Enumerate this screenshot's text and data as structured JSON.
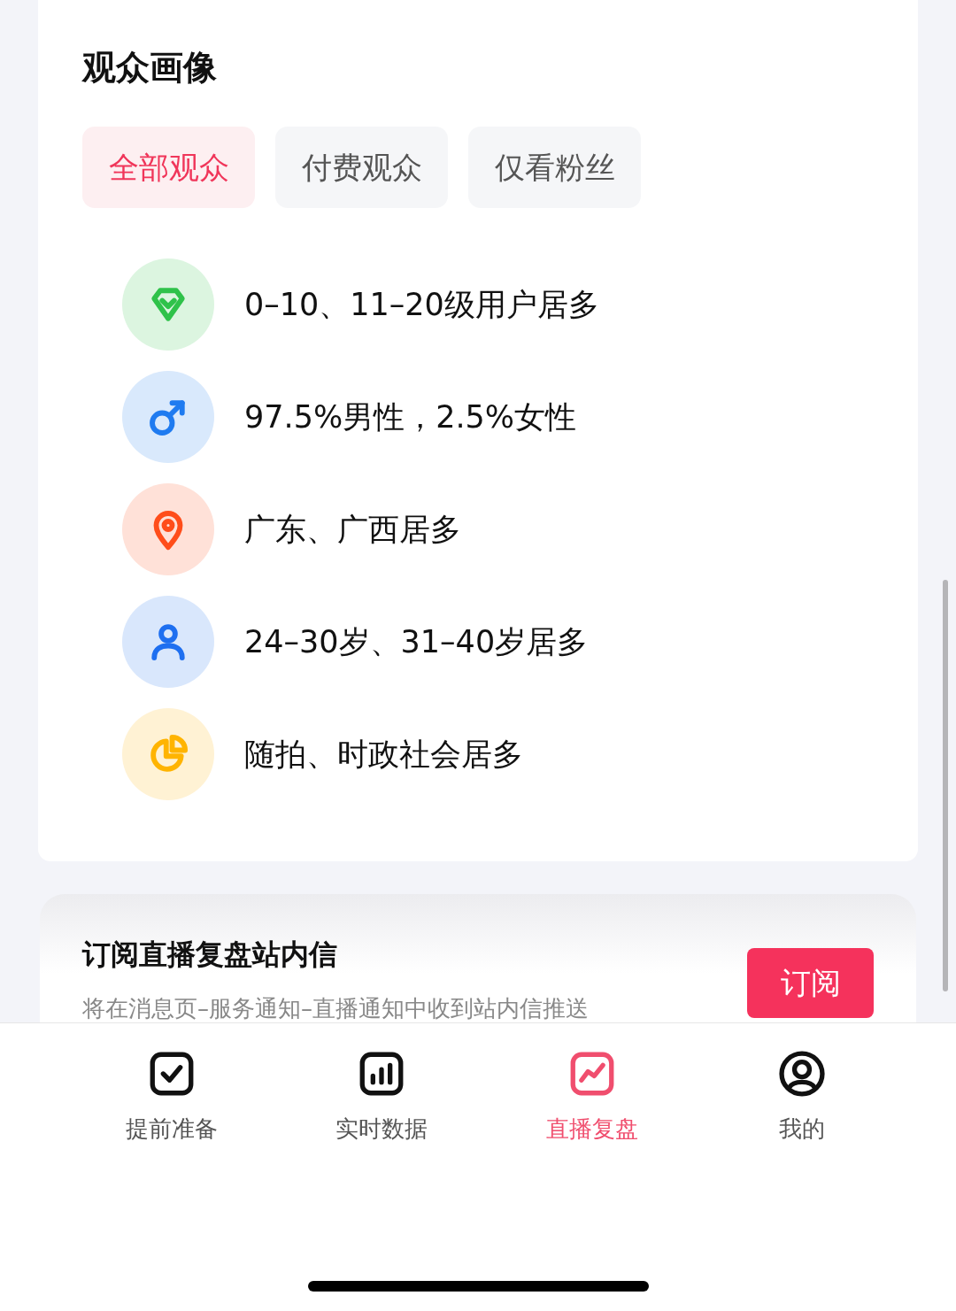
{
  "section": {
    "title": "观众画像",
    "filters": [
      {
        "label": "全部观众",
        "selected": true
      },
      {
        "label": "付费观众",
        "selected": false
      },
      {
        "label": "仅看粉丝",
        "selected": false
      }
    ],
    "insights": [
      {
        "kind": "level",
        "color": "#2fc24a",
        "text": "0–10、11–20级用户居多"
      },
      {
        "kind": "gender",
        "color": "#1f7bf0",
        "text": "97.5%男性，2.5%女性"
      },
      {
        "kind": "location",
        "color": "#ff4d1a",
        "text": "广东、广西居多"
      },
      {
        "kind": "age",
        "color": "#1e6ff0",
        "text": "24–30岁、31–40岁居多"
      },
      {
        "kind": "interest",
        "color": "#ffb400",
        "text": "随拍、时政社会居多"
      }
    ]
  },
  "subscribe": {
    "title": "订阅直播复盘站内信",
    "description": "将在消息页–服务通知–直播通知中收到站内信推送",
    "button": "订阅"
  },
  "tab_bar": [
    {
      "kind": "check",
      "label": "提前准备",
      "selected": false
    },
    {
      "kind": "chart",
      "label": "实时数据",
      "selected": false
    },
    {
      "kind": "trend",
      "label": "直播复盘",
      "selected": true
    },
    {
      "kind": "user",
      "label": "我的",
      "selected": false
    }
  ]
}
